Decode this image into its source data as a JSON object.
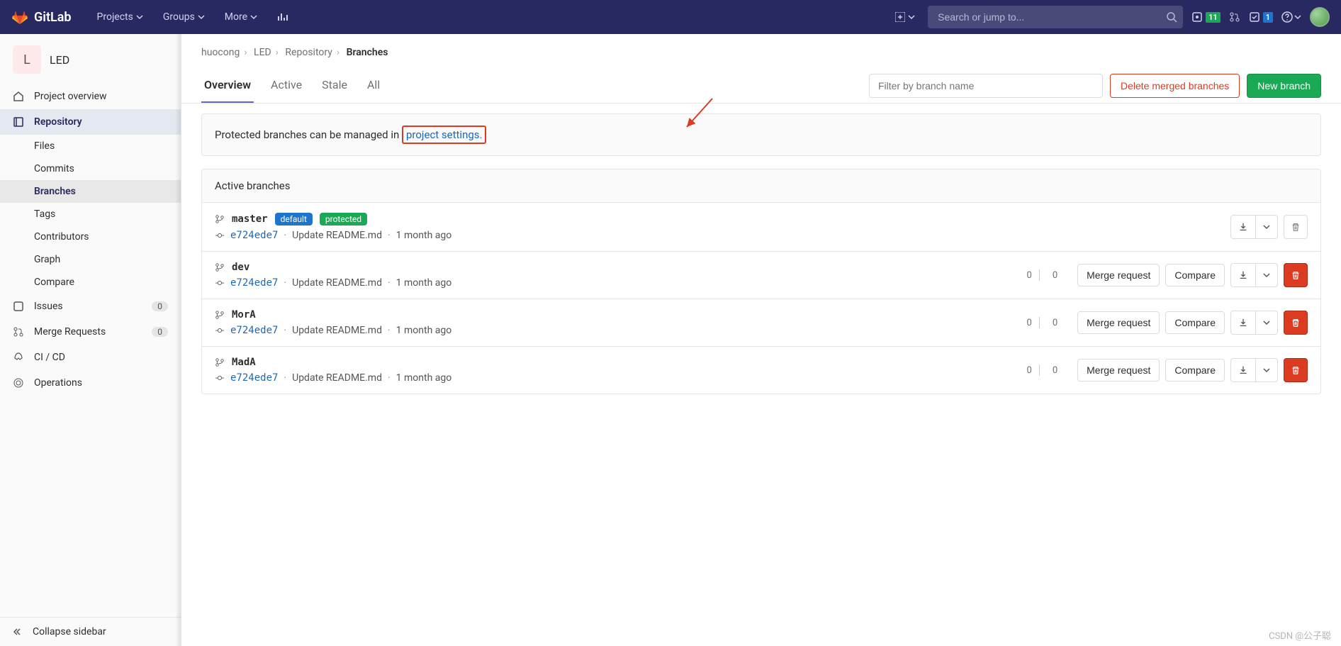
{
  "brand": "GitLab",
  "nav": {
    "projects": "Projects",
    "groups": "Groups",
    "more": "More"
  },
  "search": {
    "placeholder": "Search or jump to..."
  },
  "nav_right": {
    "issues_badge": "11",
    "todos_badge": "1"
  },
  "project": {
    "avatar_letter": "L",
    "name": "LED"
  },
  "sidebar": {
    "overview": "Project overview",
    "repository": "Repository",
    "subs": {
      "files": "Files",
      "commits": "Commits",
      "branches": "Branches",
      "tags": "Tags",
      "contributors": "Contributors",
      "graph": "Graph",
      "compare": "Compare"
    },
    "issues": "Issues",
    "issues_count": "0",
    "mrs": "Merge Requests",
    "mrs_count": "0",
    "cicd": "CI / CD",
    "operations": "Operations",
    "collapse": "Collapse sidebar"
  },
  "breadcrumb": {
    "p0": "huocong",
    "p1": "LED",
    "p2": "Repository",
    "p3": "Branches"
  },
  "tabs": {
    "overview": "Overview",
    "active": "Active",
    "stale": "Stale",
    "all": "All"
  },
  "actions": {
    "filter_placeholder": "Filter by branch name",
    "delete_merged": "Delete merged branches",
    "new_branch": "New branch",
    "merge_request": "Merge request",
    "compare": "Compare"
  },
  "alert": {
    "prefix": "Protected branches can be managed in ",
    "link": "project settings."
  },
  "section_title": "Active branches",
  "pills": {
    "default": "default",
    "protected": "protected"
  },
  "branches": [
    {
      "name": "master",
      "sha": "e724ede7",
      "msg": "Update README.md",
      "time": "1 month ago",
      "is_default": true,
      "diverge_behind": null,
      "diverge_ahead": null
    },
    {
      "name": "dev",
      "sha": "e724ede7",
      "msg": "Update README.md",
      "time": "1 month ago",
      "is_default": false,
      "diverge_behind": "0",
      "diverge_ahead": "0"
    },
    {
      "name": "MorA",
      "sha": "e724ede7",
      "msg": "Update README.md",
      "time": "1 month ago",
      "is_default": false,
      "diverge_behind": "0",
      "diverge_ahead": "0"
    },
    {
      "name": "MadA",
      "sha": "e724ede7",
      "msg": "Update README.md",
      "time": "1 month ago",
      "is_default": false,
      "diverge_behind": "0",
      "diverge_ahead": "0"
    }
  ],
  "watermark": "CSDN @公子聪"
}
